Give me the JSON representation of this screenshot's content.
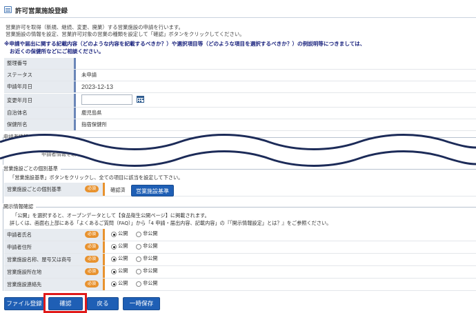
{
  "header": {
    "title": "許可営業施設登録"
  },
  "description": [
    "営業許可を取得（新規、継続、変更、廃業）する営業施設の申請を行います。",
    "営業施設の情報を設定、営業許可対象の営業の種類を設定して「確認」ボタンをクリックしてください。"
  ],
  "notice": [
    "※申請や届出に関する記載内容（どのような内容を記載するべきか？）や選択項目等（どのような項目を選択するべきか？）の例説明等につきましては、",
    "お近くの保健所などにご相談ください。"
  ],
  "info": {
    "rows": [
      {
        "label": "整理番号",
        "value": ""
      },
      {
        "label": "ステータス",
        "value": "未申請"
      },
      {
        "label": "申請年月日",
        "value": "2023-12-13"
      },
      {
        "label": "変更年月日",
        "value": ""
      },
      {
        "label": "自治体名",
        "value": "鹿児島県"
      },
      {
        "label": "保健所名",
        "value": "指宿保健所"
      }
    ]
  },
  "applicant": {
    "legend": "申請者情報",
    "partial_text": "申請者情報を取り扱う"
  },
  "kijun": {
    "legend": "営業施設ごとの個別基準",
    "note": "「営業施設基準」ボタンをクリックし、全ての項目に該当を設定して下さい。",
    "row_label": "営業施設ごとの個別基準",
    "required_badge": "必須",
    "status": "確認済",
    "button_label": "営業施設基準"
  },
  "disclosure": {
    "legend": "開示情報確認",
    "note1": "「公開」を選択すると、オープンデータとして【食品衛生公開ページ】に掲載されます。",
    "note2": "詳しくは、画面右上部にある「よくあるご質問（FAQ）」から「4 申請・届出内容、記載内容」の『「開示情報設定」とは？』をご参照ください。",
    "required_badge": "必須",
    "public_label": "公開",
    "private_label": "非公開",
    "rows": [
      {
        "label": "申請者氏名",
        "selected": "公開"
      },
      {
        "label": "申請者住所",
        "selected": "公開"
      },
      {
        "label": "営業施設名称、屋号又は商号",
        "selected": "公開"
      },
      {
        "label": "営業施設所在地",
        "selected": "公開"
      },
      {
        "label": "営業施設連絡先",
        "selected": "公開"
      }
    ]
  },
  "actions": {
    "file_label": "ファイル登録",
    "confirm_label": "確認",
    "back_label": "戻る",
    "save_label": "一時保存"
  },
  "colors": {
    "primary": "#1f5fb5",
    "required": "#e8922e",
    "highlight": "#e01919",
    "notice": "#1a237e"
  }
}
